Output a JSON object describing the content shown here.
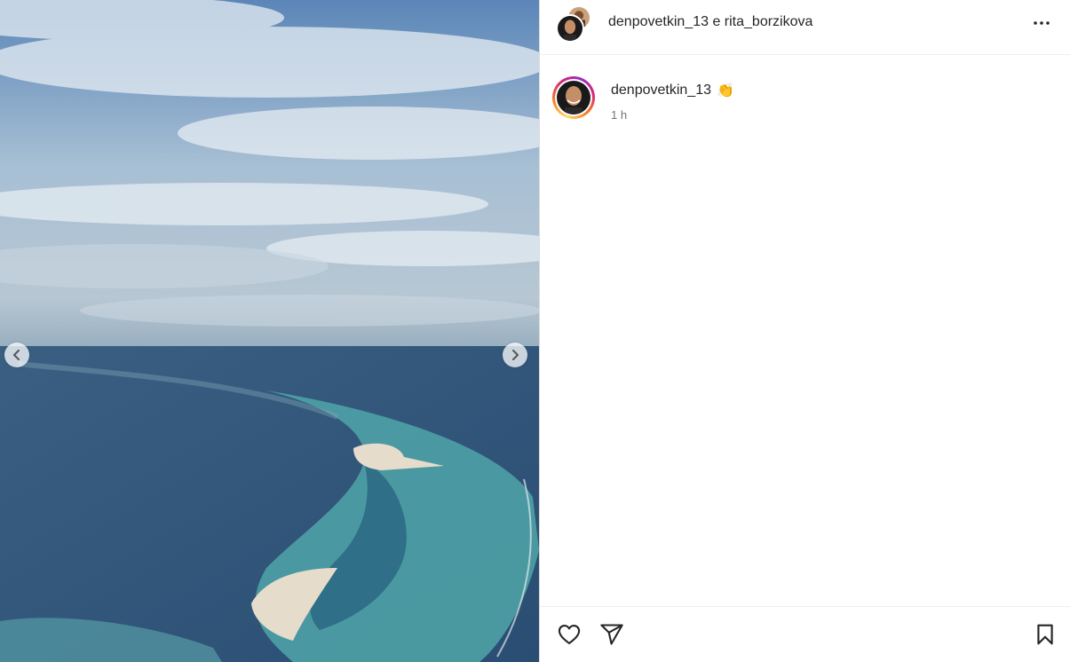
{
  "header": {
    "user1": "denpovetkin_13",
    "connector": "e",
    "user2": "rita_borzikova"
  },
  "caption": {
    "username": "denpovetkin_13",
    "emoji": "👏",
    "time": "1 h"
  },
  "icons": {
    "prev": "chevron-left-icon",
    "next": "chevron-right-icon",
    "more": "more-horizontal-icon",
    "like": "heart-icon",
    "share": "send-icon",
    "save": "bookmark-icon"
  },
  "colors": {
    "ring_start": "#feda75",
    "ring_mid": "#d62976",
    "text": "#262626",
    "muted": "#737373"
  }
}
